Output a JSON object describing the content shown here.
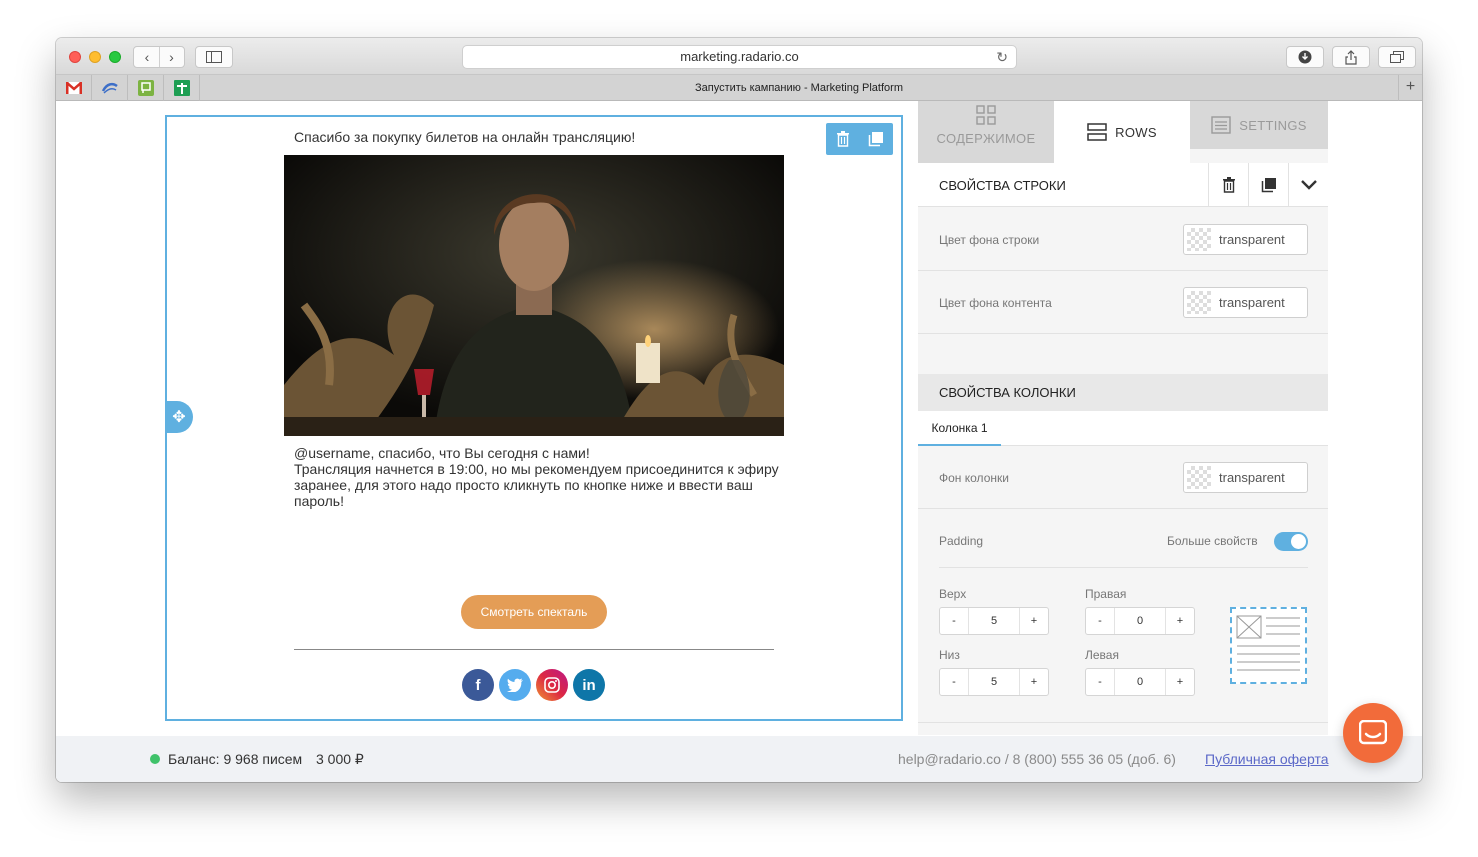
{
  "browser": {
    "url": "marketing.radario.co",
    "tab_title": "Запустить кампанию - Marketing Platform",
    "favorites": [
      "gmail-icon",
      "radario-icon",
      "chat-icon",
      "sheets-icon"
    ]
  },
  "email": {
    "title": "Спасибо за покупку билетов на онлайн трансляцию!",
    "body_line1": "@username, спасибо, что Вы сегодня с нами!",
    "body_line2": "Трансляция начнется в 19:00, но мы рекомендуем присоединится к эфиру заранее, для этого надо просто кликнуть по кнопке ниже и ввести ваш пароль!",
    "button_label": "Смотреть спекталь",
    "socials": [
      {
        "name": "facebook-icon",
        "glyph": "f",
        "color": "#3b5998"
      },
      {
        "name": "twitter-icon",
        "glyph": "t",
        "color": "#55acee"
      },
      {
        "name": "instagram-icon",
        "glyph": "◎",
        "color": "#c13584"
      },
      {
        "name": "linkedin-icon",
        "glyph": "in",
        "color": "#0e76a8"
      }
    ]
  },
  "panel": {
    "tabs": {
      "content": "СОДЕРЖИМОЕ",
      "rows": "ROWS",
      "settings": "SETTINGS"
    },
    "row_props": {
      "header": "СВОЙСТВА СТРОКИ",
      "row_bg_label": "Цвет фона строки",
      "row_bg_value": "transparent",
      "content_bg_label": "Цвет фона контента",
      "content_bg_value": "transparent"
    },
    "col_props": {
      "header": "СВОЙСТВА КОЛОНКИ",
      "tab": "Колонка 1",
      "col_bg_label": "Фон колонки",
      "col_bg_value": "transparent",
      "padding_label": "Padding",
      "more_label": "Больше свойств",
      "more_enabled": true,
      "top_label": "Верх",
      "top_value": "5",
      "right_label": "Правая",
      "right_value": "0",
      "bottom_label": "Низ",
      "bottom_value": "5",
      "left_label": "Левая",
      "left_value": "0",
      "minus": "-",
      "plus": "+"
    }
  },
  "footer": {
    "balance": "Баланс: 9 968 писем",
    "amount": "3 000 ₽",
    "help": "help@radario.co / 8 (800) 555 36 05 (доб. 6)",
    "offer": "Публичная оферта"
  },
  "colors": {
    "accent": "#5fb0e0",
    "cta": "#e49d56",
    "chat": "#f26b3a",
    "status": "#3fc26a"
  }
}
